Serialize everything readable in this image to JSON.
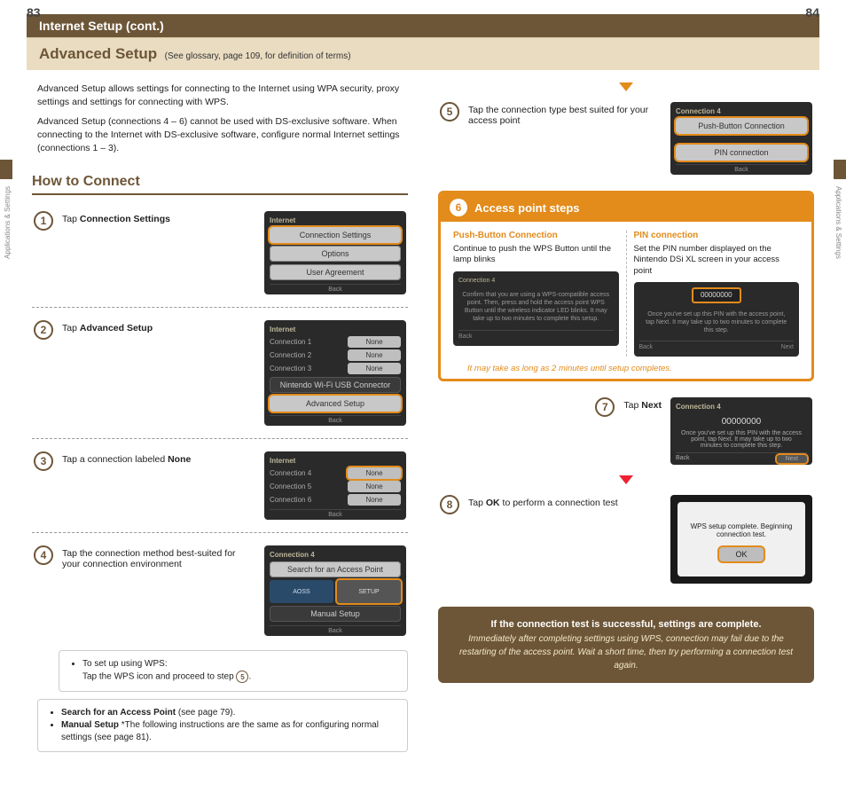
{
  "page_left_num": "83",
  "page_right_num": "84",
  "top_bar_title": "Internet Setup (cont.)",
  "sub_bar_title": "Advanced Setup",
  "sub_bar_note": "(See glossary, page 109, for definition of terms)",
  "side_label": "Applications & Settings",
  "intro_p1": "Advanced Setup allows settings for connecting to the Internet using WPA security, proxy settings and settings for connecting with WPS.",
  "intro_p2": "Advanced Setup (connections 4 – 6) cannot be used with DS-exclusive software. When connecting to the Internet with DS-exclusive software, configure normal Internet settings (connections 1 – 3).",
  "how_to_connect": "How to Connect",
  "steps": {
    "s1": {
      "pre": "Tap ",
      "b": "Connection Settings",
      "post": ""
    },
    "s2": {
      "pre": "Tap ",
      "b": "Advanced Setup",
      "post": ""
    },
    "s3": {
      "pre": "Tap a connection labeled ",
      "b": "None",
      "post": ""
    },
    "s4": "Tap the connection method best-suited for your connection environment",
    "s5": "Tap the connection type best suited for your access point",
    "s7": {
      "pre": "Tap ",
      "b": "Next",
      "post": ""
    },
    "s8": {
      "pre": "Tap ",
      "b": "OK",
      "post": " to perform a connection test"
    }
  },
  "wps_tip_line1": "To set up using WPS:",
  "wps_tip_line2_pre": "Tap the WPS icon and proceed to step ",
  "wps_tip_line2_num": "5",
  "wps_tip_line2_post": ".",
  "search_tip_1b": "Search for an Access Point",
  "search_tip_1": " (see page 79).",
  "search_tip_2b": "Manual Setup",
  "search_tip_2": "  *The following instructions are the same as for configuring normal settings (see page 81).",
  "orange": {
    "num": "6",
    "title": "Access point steps",
    "push_head": "Push-Button Connection",
    "push_desc": "Continue to push the WPS Button until the lamp blinks",
    "pin_head": "PIN connection",
    "pin_desc": "Set the PIN number displayed on the Nintendo DSi XL screen in your access point",
    "foot": "It may take as long as 2 minutes until setup completes."
  },
  "brown": {
    "head": "If the connection test is successful, settings are complete.",
    "body": "Immediately after completing settings using WPS, connection may fail due to the restarting of the access point. Wait a short time, then try performing a connection test again."
  },
  "shots": {
    "s1": {
      "hdr": "Internet",
      "btn1": "Connection Settings",
      "btn2": "Options",
      "btn3": "User Agreement",
      "back": "Back"
    },
    "s2": {
      "hdr": "Internet",
      "c1": "Connection 1",
      "c2": "Connection 2",
      "c3": "Connection 3",
      "none": "None",
      "usb": "Nintendo Wi-Fi USB Connector",
      "adv": "Advanced Setup",
      "back": "Back"
    },
    "s3": {
      "hdr": "Internet",
      "c4": "Connection 4",
      "c5": "Connection 5",
      "c6": "Connection 6",
      "none": "None",
      "back": "Back"
    },
    "s4": {
      "hdr": "Connection 4",
      "search": "Search for an Access Point",
      "aoss": "AOSS",
      "wps": "SETUP",
      "manual": "Manual Setup",
      "back": "Back"
    },
    "s5": {
      "hdr": "Connection 4",
      "push": "Push-Button Connection",
      "pin": "PIN connection",
      "back": "Back"
    },
    "push_body": "Confirm that you are using a WPS-compatible access point. Then, press and hold the access point WPS Button until the wireless indicator LED blinks. It may take up to two minutes to complete this setup.",
    "pin_code": "00000000",
    "pin_body": "Once you've set up this PIN with the access point, tap Next. It may take up to two minutes to complete this step.",
    "s7": {
      "hdr": "Connection 4",
      "code": "00000000",
      "body": "Once you've set up this PIN with the access point, tap Next. It may take up to two minutes to complete this step.",
      "back": "Back",
      "next": "Next"
    },
    "s8": {
      "msg": "WPS setup complete. Beginning connection test.",
      "ok": "OK"
    },
    "back": "Back",
    "next": "Next"
  }
}
